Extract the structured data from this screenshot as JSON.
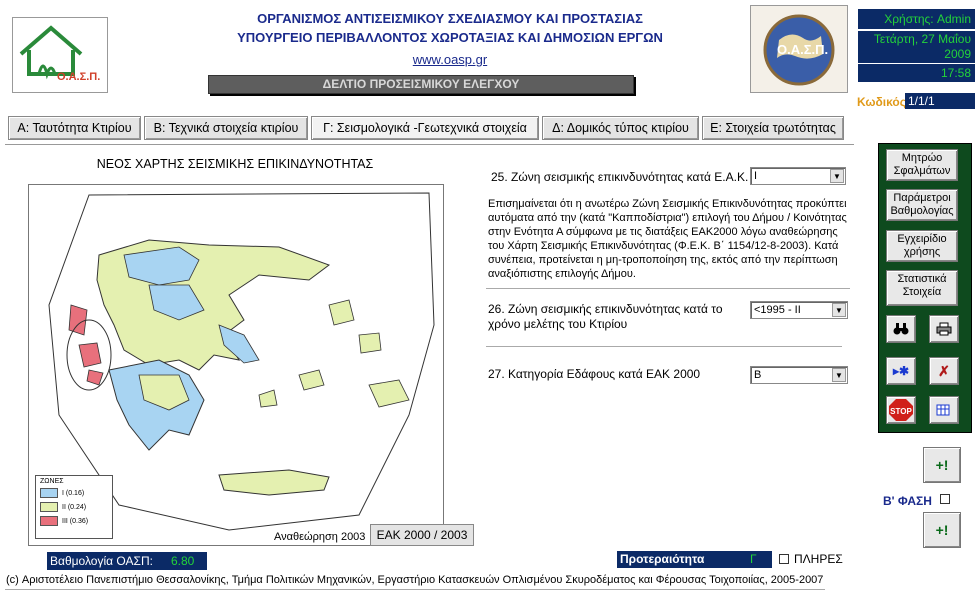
{
  "header": {
    "org_line1": "ΟΡΓΑΝΙΣΜΟΣ ΑΝΤΙΣΕΙΣΜΙΚΟΥ ΣΧΕΔΙΑΣΜΟΥ ΚΑΙ ΠΡΟΣΤΑΣΙΑΣ",
    "org_line2": "ΥΠΟΥΡΓΕΙΟ ΠΕΡΙΒΑΛΛΟΝΤΟΣ ΧΩΡΟΤΑΞΙΑΣ ΚΑΙ ΔΗΜΟΣΙΩΝ ΕΡΓΩΝ",
    "url": "www.oasp.gr",
    "form_title": "ΔΕΛΤΙΟ ΠΡΟΣΕΙΣΜΙΚΟΥ ΕΛΕΓΧΟΥ",
    "logo_text": "Ο.Α.Σ.Π.",
    "seal_text": "Ο.Α.Σ.Π."
  },
  "session": {
    "user": "Χρήστης: Admin",
    "date_line1": "Τετάρτη, 27 Μαΐου",
    "date_line2": "2009",
    "time": "17:58",
    "code_label": "Κωδικός",
    "code_value": "1/1/1"
  },
  "tabs": [
    {
      "label": "Α: Ταυτότητα Κτιρίου"
    },
    {
      "label": "Β: Τεχνικά στοιχεία κτιρίου"
    },
    {
      "label": "Γ: Σεισμολογικά -Γεωτεχνικά στοιχεία"
    },
    {
      "label": "Δ: Δομικός τύπος κτιρίου"
    },
    {
      "label": "Ε: Στοιχεία τρωτότητας"
    }
  ],
  "map": {
    "title": "ΝΕΟΣ ΧΑΡΤΗΣ ΣΕΙΣΜΙΚΗΣ ΕΠΙΚΙΝΔΥΝΟΤΗΤΑΣ",
    "legend_title": "ΖΩΝΕΣ",
    "legend": [
      {
        "label": "I    (0.16)",
        "color": "#a8d4f2"
      },
      {
        "label": "II   (0.24)",
        "color": "#e4f0b0"
      },
      {
        "label": "III  (0.36)",
        "color": "#e8707c"
      }
    ],
    "revision": "Αναθεώρηση 2003",
    "eak_button": "ΕΑΚ 2000 / 2003"
  },
  "form": {
    "q25_label": "25. Ζώνη σεισμικής επικινδυνότητας κατά Ε.Α.Κ.",
    "q25_value": "I",
    "q25_note": "Επισημαίνεται ότι η ανωτέρω Ζώνη Σεισμικής Επικινδυνότητας προκύπτει αυτόματα από την (κατά \"Καπποδίστρια\") επιλογή του Δήμου / Κοινότητας στην Ενότητα Α σύμφωνα με τις διατάξεις ΕΑΚ2000 λόγω αναθεώρησης του Χάρτη Σεισμικής Επικινδυνότητας (Φ.Ε.Κ. Β΄ 1154/12-8-2003). Κατά συνέπεια, προτείνεται η μη-τροποποίηση της, εκτός από την περίπτωση αναξιόπιστης επιλογής Δήμου.",
    "q26_label": "26. Ζώνη σεισμικής επικινδυνότητας κατά το χρόνο μελέτης του Κτιρίου",
    "q26_value": "<1995 - II",
    "q27_label": "27. Κατηγορία Εδάφους κατά ΕΑΚ 2000",
    "q27_value": "Β"
  },
  "side": {
    "btn_registry": "Μητρώο Σφαλμάτων",
    "btn_params": "Παράμετροι Βαθμολογίας",
    "btn_manual": "Εγχειρίδιο χρήσης",
    "btn_stats": "Στατιστικά Στοιχεία",
    "phase_label": "Β' ΦΑΣΗ",
    "plus_label": "+!"
  },
  "bottom": {
    "score_label": "Βαθμολογία ΟΑΣΠ:",
    "score_value": "6.80",
    "priority_label": "Προτεραιότητα",
    "priority_value": "Γ",
    "full_label": "ΠΛΗΡΕΣ",
    "footer": "(c) Αριστοτέλειο Πανεπιστήμιο Θεσσαλονίκης, Τμήμα Πολιτικών Μηχανικών, Εργαστήριο Κατασκευών Οπλισμένου Σκυροδέματος και Φέρουσας Τοιχοποιίας,  2005-2007"
  },
  "colors": {
    "navy": "#0b2a66",
    "green_text": "#23d23a",
    "panel_green": "#0e4a1e",
    "title_blue": "#1a2a8c"
  }
}
